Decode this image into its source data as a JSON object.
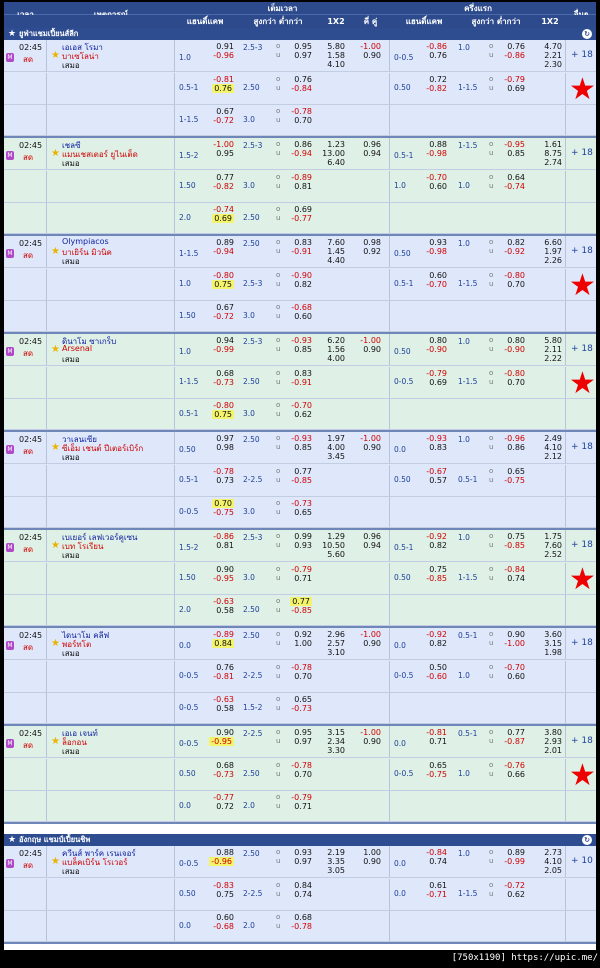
{
  "header": {
    "time": "เวลา",
    "event": "เหตุการณ์",
    "full": "เต็มเวลา",
    "first_half": "ครึ่งแรก",
    "hdp": "แฮนดิ์แคพ",
    "ou": "สูงกว่า ต่ำกว่า",
    "x12": "1X2",
    "oe": "คี่ คู่",
    "more": "อื่นๆ"
  },
  "leagues": [
    {
      "name": "ยูฟ่าแชมเปี้ยนส์ลีก"
    },
    {
      "name": "อังกฤษ แชมป์เปี้ยนชิพ"
    }
  ],
  "ou_labels": {
    "o": "o",
    "u": "u"
  },
  "matches": [
    {
      "time": "02:45",
      "live": "สด",
      "home": "เอเอส โรมา",
      "away": "บาเซโลน่า",
      "draw": "เสมอ",
      "more": "+ 18",
      "star": false,
      "rows": [
        {
          "hdp": "1.0",
          "h1": "0.91",
          "h2": "-0.96",
          "ou": "2.5-3",
          "o": "0.95",
          "u": "0.97",
          "x1": "5.80",
          "x2": "1.58",
          "x3": "4.10",
          "oe1": "-1.00",
          "oe2": "0.90",
          "fhdp": "0-0.5",
          "fh1": "-0.86",
          "fh2": "0.76",
          "fou": "1.0",
          "fo": "0.76",
          "fu": "-0.86",
          "fx1": "4.70",
          "fx2": "2.21",
          "fx3": "2.30"
        },
        {
          "hdp": "0.5-1",
          "h1": "-0.81",
          "h2": "0.76",
          "ou": "2.50",
          "o": "0.76",
          "u": "-0.84",
          "fhdp": "0.50",
          "fh1": "0.72",
          "fh2": "-0.82",
          "fou": "1-1.5",
          "fo": "-0.79",
          "fu": "0.69"
        },
        {
          "hdp": "1-1.5",
          "h1": "0.67",
          "h2": "-0.72",
          "ou": "3.0",
          "o": "-0.78",
          "u": "0.70"
        }
      ]
    },
    {
      "time": "02:45",
      "live": "สด",
      "home": "เชลซี",
      "away": "แมนเชสเตอร์ ยูไนเต็ด",
      "draw": "เสมอ",
      "more": "+ 18",
      "star": false,
      "rows": [
        {
          "hdp": "1.5-2",
          "h1": "-1.00",
          "h2": "0.95",
          "ou": "2.5-3",
          "o": "0.86",
          "u": "-0.94",
          "x1": "1.23",
          "x2": "13.00",
          "x3": "6.40",
          "oe1": "0.96",
          "oe2": "0.94",
          "fhdp": "0.5-1",
          "fh1": "0.88",
          "fh2": "-0.98",
          "fou": "1-1.5",
          "fo": "-0.95",
          "fu": "0.85",
          "fx1": "1.61",
          "fx2": "8.75",
          "fx3": "2.74"
        },
        {
          "hdp": "1.50",
          "h1": "0.77",
          "h2": "-0.82",
          "ou": "3.0",
          "o": "-0.89",
          "u": "0.81",
          "fhdp": "1.0",
          "fh1": "-0.70",
          "fh2": "0.60",
          "fou": "1.0",
          "fo": "0.64",
          "fu": "-0.74"
        },
        {
          "hdp": "2.0",
          "h1": "-0.74",
          "h2": "0.69",
          "ou": "2.50",
          "o": "0.69",
          "u": "-0.77"
        }
      ]
    },
    {
      "time": "02:45",
      "live": "สด",
      "home": "Olympiacos",
      "away": "บาเยิร์น มิวนิค",
      "draw": "เสมอ",
      "more": "+ 18",
      "star": false,
      "rows": [
        {
          "hdp": "1-1.5",
          "h1": "0.89",
          "h2": "-0.94",
          "ou": "2.50",
          "o": "0.83",
          "u": "-0.91",
          "x1": "7.60",
          "x2": "1.45",
          "x3": "4.40",
          "oe1": "0.98",
          "oe2": "0.92",
          "fhdp": "0.50",
          "fh1": "0.93",
          "fh2": "-0.98",
          "fou": "1.0",
          "fo": "0.82",
          "fu": "-0.92",
          "fx1": "6.60",
          "fx2": "1.97",
          "fx3": "2.26"
        },
        {
          "hdp": "1.0",
          "h1": "-0.80",
          "h2": "0.75",
          "ou": "2.5-3",
          "o": "-0.90",
          "u": "0.82",
          "fhdp": "0.5-1",
          "fh1": "0.60",
          "fh2": "-0.70",
          "fou": "1-1.5",
          "fo": "-0.80",
          "fu": "0.70"
        },
        {
          "hdp": "1.50",
          "h1": "0.67",
          "h2": "-0.72",
          "ou": "3.0",
          "o": "-0.68",
          "u": "0.60"
        }
      ]
    },
    {
      "time": "02:45",
      "live": "สด",
      "home": "ดินาโม ซาเกร็บ",
      "away": "Arsenal",
      "draw": "เสมอ",
      "more": "+ 18",
      "star": false,
      "rows": [
        {
          "hdp": "1.0",
          "h1": "0.94",
          "h2": "-0.99",
          "ou": "2.5-3",
          "o": "-0.93",
          "u": "0.85",
          "x1": "6.20",
          "x2": "1.56",
          "x3": "4.00",
          "oe1": "-1.00",
          "oe2": "0.90",
          "fhdp": "0.50",
          "fh1": "0.80",
          "fh2": "-0.90",
          "fou": "1.0",
          "fo": "0.80",
          "fu": "-0.90",
          "fx1": "5.80",
          "fx2": "2.11",
          "fx3": "2.22"
        },
        {
          "hdp": "1-1.5",
          "h1": "0.68",
          "h2": "-0.73",
          "ou": "2.50",
          "o": "0.83",
          "u": "-0.91",
          "fhdp": "0-0.5",
          "fh1": "-0.79",
          "fh2": "0.69",
          "fou": "1-1.5",
          "fo": "-0.80",
          "fu": "0.70"
        },
        {
          "hdp": "0.5-1",
          "h1": "-0.80",
          "h2": "0.75",
          "ou": "3.0",
          "o": "-0.70",
          "u": "0.62"
        }
      ]
    },
    {
      "time": "02:45",
      "live": "สด",
      "home": "วาเลนเซีย",
      "away": "ซีเอ็ม เชนต์ ปีเตอร์เบิร์ก",
      "draw": "เสมอ",
      "more": "+ 18",
      "star": false,
      "rows": [
        {
          "hdp": "0.50",
          "h1": "0.97",
          "h2": "0.98",
          "ou": "2.50",
          "o": "-0.93",
          "u": "0.85",
          "x1": "1.97",
          "x2": "4.00",
          "x3": "3.45",
          "oe1": "-1.00",
          "oe2": "0.90",
          "fhdp": "0.0",
          "fh1": "-0.93",
          "fh2": "0.83",
          "fou": "1.0",
          "fo": "-0.96",
          "fu": "0.86",
          "fx1": "2.49",
          "fx2": "4.10",
          "fx3": "2.12"
        },
        {
          "hdp": "0.5-1",
          "h1": "-0.78",
          "h2": "0.73",
          "ou": "2-2.5",
          "o": "0.77",
          "u": "-0.85",
          "fhdp": "0.50",
          "fh1": "-0.67",
          "fh2": "0.57",
          "fou": "0.5-1",
          "fo": "0.65",
          "fu": "-0.75"
        },
        {
          "hdp": "0-0.5",
          "h1": "0.70",
          "h2": "-0.75",
          "ou": "3.0",
          "o": "-0.73",
          "u": "0.65"
        }
      ]
    },
    {
      "time": "02:45",
      "live": "สด",
      "home": "เบเยอร์ เลฟเวอร์คูเซน",
      "away": "เบท โรเรียน",
      "draw": "เสมอ",
      "more": "+ 18",
      "star": false,
      "rows": [
        {
          "hdp": "1.5-2",
          "h1": "-0.86",
          "h2": "0.81",
          "ou": "2.5-3",
          "o": "0.99",
          "u": "0.93",
          "x1": "1.29",
          "x2": "10.50",
          "x3": "5.60",
          "oe1": "0.96",
          "oe2": "0.94",
          "fhdp": "0.5-1",
          "fh1": "-0.92",
          "fh2": "0.82",
          "fou": "1.0",
          "fo": "0.75",
          "fu": "-0.85",
          "fx1": "1.75",
          "fx2": "7.60",
          "fx3": "2.52"
        },
        {
          "hdp": "1.50",
          "h1": "0.90",
          "h2": "-0.95",
          "ou": "3.0",
          "o": "-0.79",
          "u": "0.71",
          "fhdp": "0.50",
          "fh1": "0.75",
          "fh2": "-0.85",
          "fou": "1-1.5",
          "fo": "-0.84",
          "fu": "0.74"
        },
        {
          "hdp": "2.0",
          "h1": "-0.63",
          "h2": "0.58",
          "ou": "2.50",
          "o": "0.77",
          "u": "-0.85"
        }
      ]
    },
    {
      "time": "02:45",
      "live": "สด",
      "home": "ไดนาโม คลีฟ",
      "away": "พอร์ทโต",
      "draw": "เสมอ",
      "more": "+ 18",
      "star": false,
      "rows": [
        {
          "hdp": "0.0",
          "h1": "-0.89",
          "h2": "0.84",
          "ou": "2.50",
          "o": "0.92",
          "u": "1.00",
          "x1": "2.96",
          "x2": "2.57",
          "x3": "3.10",
          "oe1": "-1.00",
          "oe2": "0.90",
          "fhdp": "0.0",
          "fh1": "-0.92",
          "fh2": "0.82",
          "fou": "0.5-1",
          "fo": "0.90",
          "fu": "-1.00",
          "fx1": "3.60",
          "fx2": "3.15",
          "fx3": "1.98"
        },
        {
          "hdp": "0-0.5",
          "h1": "0.76",
          "h2": "-0.81",
          "ou": "2-2.5",
          "o": "-0.78",
          "u": "0.70",
          "fhdp": "0-0.5",
          "fh1": "0.50",
          "fh2": "-0.60",
          "fou": "1.0",
          "fo": "-0.70",
          "fu": "0.60"
        },
        {
          "hdp": "0-0.5",
          "h1": "-0.63",
          "h2": "0.58",
          "ou": "1.5-2",
          "o": "0.65",
          "u": "-0.73"
        }
      ]
    },
    {
      "time": "02:45",
      "live": "สด",
      "home": "เอเอ เจนท์",
      "away": "ล็อกอน",
      "draw": "เสมอ",
      "more": "+ 18",
      "star": false,
      "rows": [
        {
          "hdp": "0-0.5",
          "h1": "0.90",
          "h2": "-0.95",
          "ou": "2-2.5",
          "o": "0.95",
          "u": "0.97",
          "x1": "3.15",
          "x2": "2.34",
          "x3": "3.30",
          "oe1": "-1.00",
          "oe2": "0.90",
          "fhdp": "0.0",
          "fh1": "-0.81",
          "fh2": "0.71",
          "fou": "0.5-1",
          "fo": "0.77",
          "fu": "-0.87",
          "fx1": "3.80",
          "fx2": "2.93",
          "fx3": "2.01"
        },
        {
          "hdp": "0.50",
          "h1": "0.68",
          "h2": "-0.73",
          "ou": "2.50",
          "o": "-0.78",
          "u": "0.70",
          "fhdp": "0-0.5",
          "fh1": "0.65",
          "fh2": "-0.75",
          "fou": "1.0",
          "fo": "-0.76",
          "fu": "0.66"
        },
        {
          "hdp": "0.0",
          "h1": "-0.77",
          "h2": "0.72",
          "ou": "2.0",
          "o": "-0.79",
          "u": "0.71"
        }
      ]
    },
    {
      "time": "02:45",
      "live": "สด",
      "home": "ควีนส์ พาร์ค เรนเจอร์",
      "away": "แบล็คเบิร์น โรเวอร์",
      "draw": "เสมอ",
      "more": "+ 10",
      "star": false,
      "rows": [
        {
          "hdp": "0-0.5",
          "h1": "0.88",
          "h2": "-0.96",
          "ou": "2.50",
          "o": "0.93",
          "u": "0.97",
          "x1": "2.19",
          "x2": "3.35",
          "x3": "3.05",
          "oe1": "1.00",
          "oe2": "0.90",
          "fhdp": "0.0",
          "fh1": "-0.84",
          "fh2": "0.74",
          "fou": "1.0",
          "fo": "0.89",
          "fu": "-0.99",
          "fx1": "2.73",
          "fx2": "4.10",
          "fx3": "2.05"
        },
        {
          "hdp": "0.50",
          "h1": "-0.83",
          "h2": "0.75",
          "ou": "2-2.5",
          "o": "0.84",
          "u": "0.74",
          "fhdp": "0.0",
          "fh1": "0.61",
          "fh2": "-0.71",
          "fou": "1-1.5",
          "fo": "-0.72",
          "fu": "0.62"
        },
        {
          "hdp": "0.0",
          "h1": "0.60",
          "h2": "-0.68",
          "ou": "2.0",
          "o": "0.68",
          "u": "-0.78"
        }
      ]
    }
  ],
  "highlights": [
    "0.76",
    "0.69",
    "0.75",
    "0.75",
    "0.70",
    "0.77",
    "0.84",
    "-0.95",
    "-0.96"
  ],
  "watermark": "[750x1190] https://upic.me/",
  "colors": {
    "header": "#2c4a8c",
    "row_blue": "#dfe8fb",
    "row_green": "#dff0e6",
    "highlight": "#f3f36c",
    "red": "#d00000",
    "blue": "#1022a0",
    "star": "#ee0000"
  }
}
